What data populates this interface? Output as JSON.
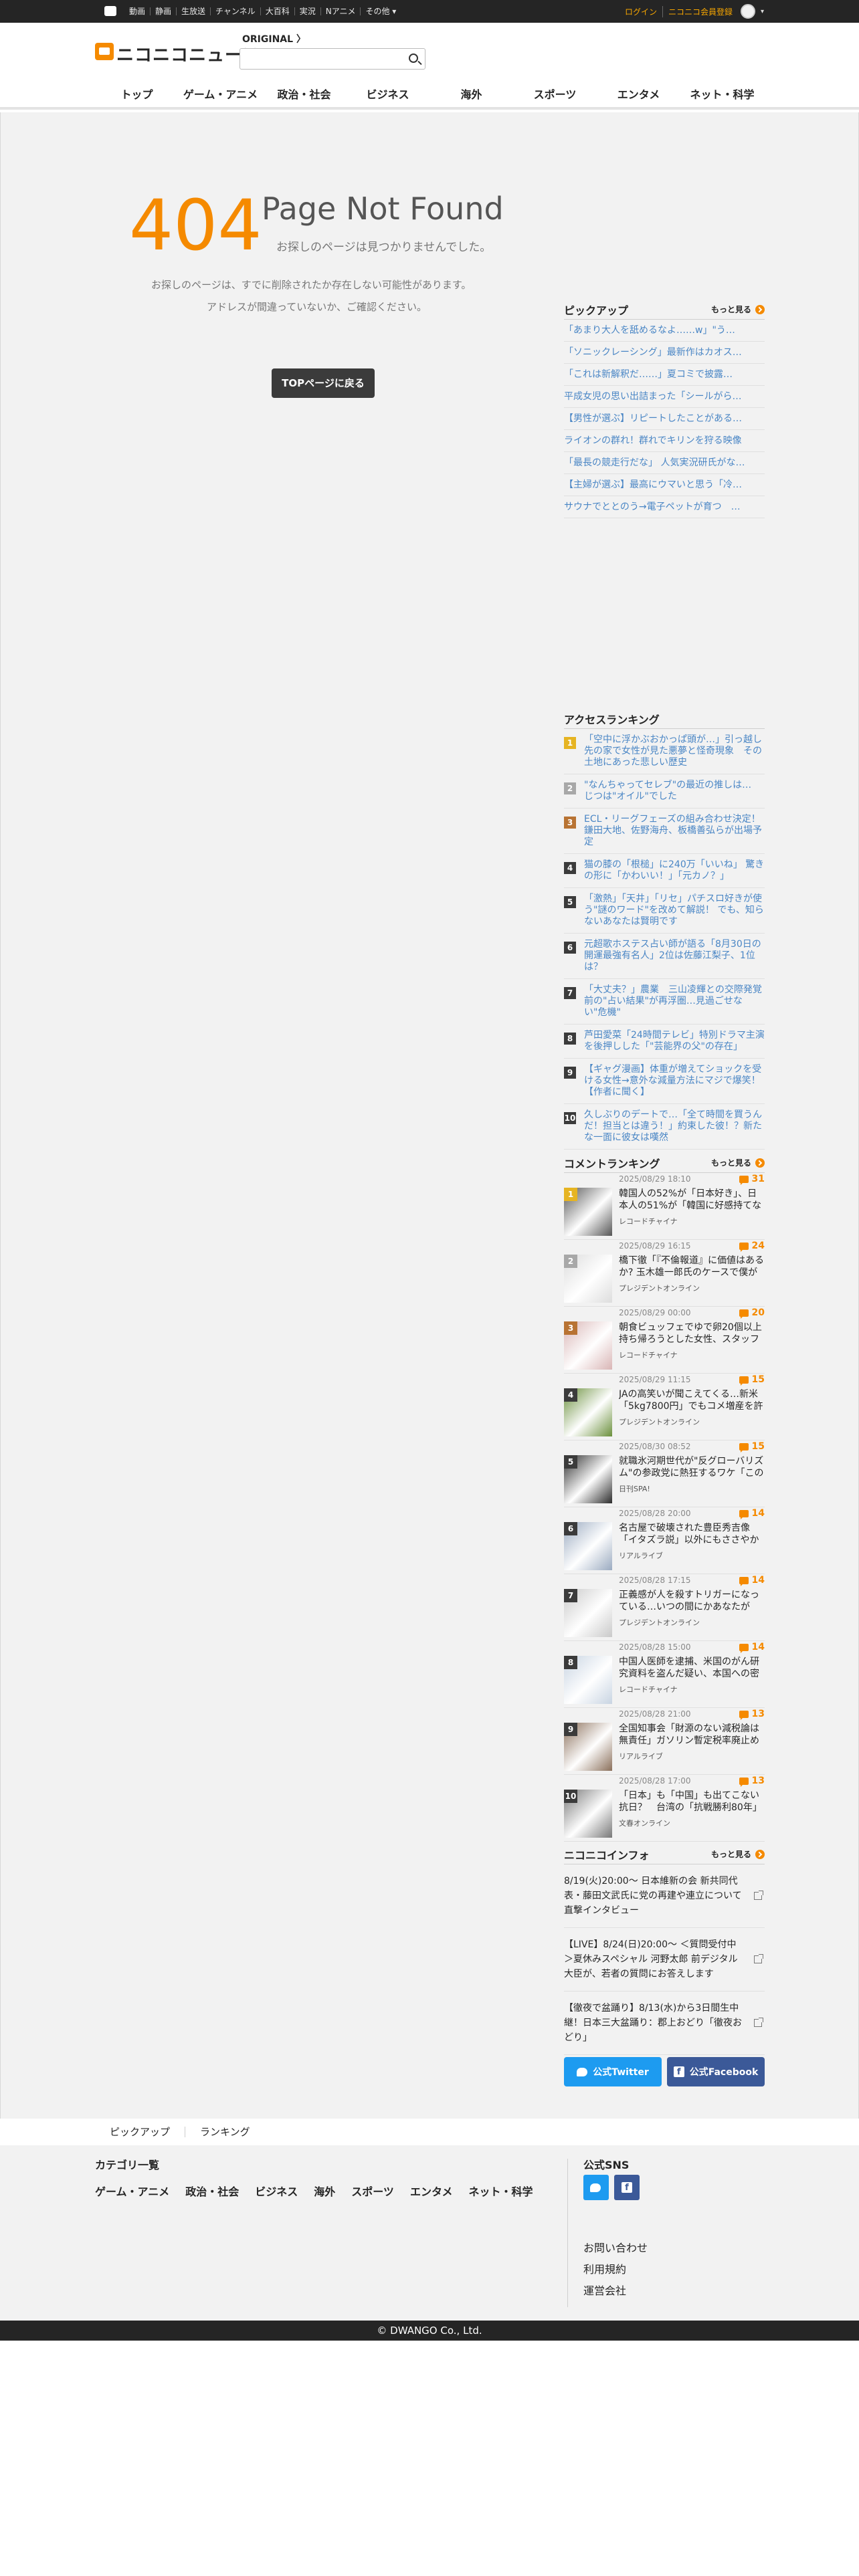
{
  "topbar": {
    "nav": [
      "動画",
      "静画",
      "生放送",
      "チャンネル",
      "大百科",
      "実況",
      "Nアニメ",
      "その他 ▾"
    ],
    "login": "ログイン",
    "register": "ニコニコ会員登録",
    "caret": "▾"
  },
  "header": {
    "logo": "ニコニコニュース",
    "original": "ORIGINAL  〉",
    "search_placeholder": "",
    "nav": [
      "トップ",
      "ゲーム・アニメ",
      "政治・社会",
      "ビジネス",
      "海外",
      "スポーツ",
      "エンタメ",
      "ネット・科学"
    ]
  },
  "error": {
    "code": "404",
    "title": "Page Not Found",
    "subtitle": "お探しのページは見つかりませんでした。",
    "message1": "お探しのページは、すでに削除されたか存在しない可能性があります。",
    "message2": "アドレスが間違っていないか、ご確認ください。",
    "top_button": "TOPページに戻る"
  },
  "pickup": {
    "title": "ピックアップ",
    "more": "もっと見る",
    "items": [
      "「あまり大人を舐めるなよ……w」\"う…",
      "「ソニックレーシング」最新作はカオス…",
      "「これは新解釈だ……」夏コミで披露…",
      "平成女児の思い出詰まった「シールがら…",
      "【男性が選ぶ】リピートしたことがある…",
      "ライオンの群れ！群れでキリンを狩る映像",
      "「最長の競走行だな」 人気実況研氏がな…",
      "【主婦が選ぶ】最高にウマいと思う「冷…",
      "サウナでととのう→電子ペットが育つ　…"
    ]
  },
  "access_ranking": {
    "title": "アクセスランキング",
    "items": [
      "「空中に浮かぶおかっぱ頭が…」引っ越し先の家で女性が見た悪夢と怪奇現象　その土地にあった悲しい歴史",
      "\"なんちゃってセレブ\"の最近の推しは…　じつは\"オイル\"でした",
      "ECL・リーグフェーズの組み合わせ決定！鎌田大地、佐野海舟、板橋善弘らが出場予定",
      "猫の膝の「根槌」に240万「いいね」 驚きの形に「かわいい！」「元カノ？」",
      "「激熱」「天井」「リセ」パチスロ好きが使う\"謎のワード\"を改めて解説！ でも、知らないあなたは賢明です",
      "元超歌ホステス占い師が語る「8月30日の開運最強有名人」2位は佐藤江梨子、1位は？",
      "「大丈夫？」農業　三山凌輝との交際発覚前の\"占い結果\"が再浮圏…見過ごせない\"危機\"",
      "芦田愛菜「24時間テレビ」特別ドラマ主演を後押しした「\"芸能界の父\"の存在」",
      "【ギャグ漫画】体重が増えてショックを受ける女性→意外な減量方法にマジで爆笑！【作者に聞く】",
      "久しぶりのデートで…「全て時間を買うんだ！担当とは違う！」約束した彼！？新たな一面に彼女は嘆然"
    ]
  },
  "comment_ranking": {
    "title": "コメントランキング",
    "more": "もっと見る",
    "items": [
      {
        "rank": "1",
        "date": "2025/08/29 18:10",
        "count": "31",
        "title": "韓国人の52%が「日本好き」、日本人の51%が「韓国に好感持てな",
        "source": "レコードチャイナ"
      },
      {
        "rank": "2",
        "date": "2025/08/29 16:15",
        "count": "24",
        "title": "橋下徹「『不倫報道』に価値はあるか? 玉木雄一郎氏のケースで僕が",
        "source": "プレジデントオンライン"
      },
      {
        "rank": "3",
        "date": "2025/08/29 00:00",
        "count": "20",
        "title": "朝食ビュッフェでゆで卵20個以上持ち帰ろうとした女性、スタッフ",
        "source": "レコードチャイナ"
      },
      {
        "rank": "4",
        "date": "2025/08/29 11:15",
        "count": "15",
        "title": "JAの高笑いが聞こえてくる…新米「5kg7800円」でもコメ増産を許さ",
        "source": "プレジデントオンライン"
      },
      {
        "rank": "5",
        "date": "2025/08/30 08:52",
        "count": "15",
        "title": "就職氷河期世代が\"反グローバリズム\"の参政党に熱狂するワケ「この",
        "source": "日刊SPA!"
      },
      {
        "rank": "6",
        "date": "2025/08/28 20:00",
        "count": "14",
        "title": "名古屋で破壊された豊臣秀吉像「イタズラ説」以外にもささやか",
        "source": "リアルライブ"
      },
      {
        "rank": "7",
        "date": "2025/08/28 17:15",
        "count": "14",
        "title": "正義感が人を殺すトリガーになっている…いつの間にかあなたが「ネ",
        "source": "プレジデントオンライン"
      },
      {
        "rank": "8",
        "date": "2025/08/28 15:00",
        "count": "14",
        "title": "中国人医師を逮捕、米国のがん研究資料を盗んだ疑い、本国への密",
        "source": "レコードチャイナ"
      },
      {
        "rank": "9",
        "date": "2025/08/28 21:00",
        "count": "13",
        "title": "全国知事会「財源のない減税論は無責任」ガソリン暫定税率廃止め",
        "source": "リアルライブ"
      },
      {
        "rank": "10",
        "date": "2025/08/28 17:00",
        "count": "13",
        "title": "「日本」も「中国」も出てこない抗日？　台湾の「抗戦勝利80年」",
        "source": "文春オンライン"
      }
    ]
  },
  "info": {
    "title": "ニコニコインフォ",
    "more": "もっと見る",
    "items": [
      "8/19(火)20:00～ 日本維新の会 新共同代表・藤田文武氏に党の再建や連立について直撃インタビュー",
      "【LIVE】8/24(日)20:00～ ＜質問受付中＞夏休みスペシャル 河野太郎 前デジタル大臣が、若者の質問にお答えします",
      "【徹夜で盆踊り】8/13(水)から3日間生中継！日本三大盆踊り：郡上おどり「徹夜おどり」"
    ]
  },
  "sns_buttons": {
    "twitter": "公式Twitter",
    "facebook": "公式Facebook",
    "fb_letter": "f"
  },
  "footer": {
    "nav": [
      "ピックアップ",
      "ランキング"
    ],
    "categories_title": "カテゴリ一覧",
    "categories": [
      "ゲーム・アニメ",
      "政治・社会",
      "ビジネス",
      "海外",
      "スポーツ",
      "エンタメ",
      "ネット・科学"
    ],
    "sns_title": "公式SNS",
    "links": [
      "お問い合わせ",
      "利用規約",
      "運営会社"
    ],
    "copyright": "© DWANGO Co., Ltd."
  },
  "colors": {
    "brand": "#f58a00",
    "link": "#4a86c5",
    "twitter": "#1d9bf0",
    "facebook": "#3b5998"
  }
}
